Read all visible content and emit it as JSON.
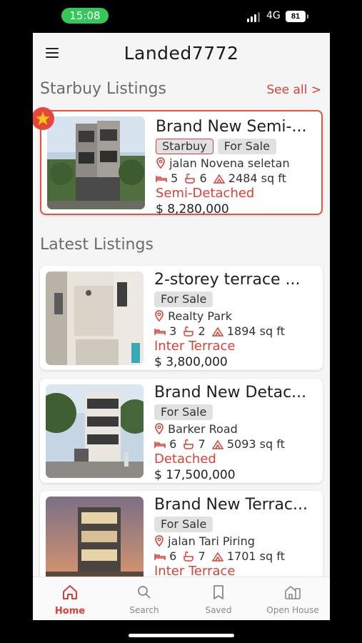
{
  "status_bar": {
    "time": "15:08",
    "network": "4G",
    "battery": "81"
  },
  "header": {
    "title": "Landed7772"
  },
  "starbuy": {
    "section_title": "Starbuy Listings",
    "see_all": "See all >",
    "listing": {
      "title": "Brand New Semi-...",
      "tags": [
        "Starbuy",
        "For Sale"
      ],
      "location": "jalan Novena seletan",
      "beds": "5",
      "baths": "6",
      "area": "2484 sq ft",
      "type": "Semi-Detached",
      "price": "$ 8,280,000"
    }
  },
  "latest": {
    "section_title": "Latest Listings",
    "listings": [
      {
        "title": "2-storey terrace ...",
        "tag": "For Sale",
        "location": "Realty Park",
        "beds": "3",
        "baths": "2",
        "area": "1894 sq ft",
        "type": "Inter Terrace",
        "price": "$ 3,800,000"
      },
      {
        "title": "Brand New Detac...",
        "tag": "For Sale",
        "location": "Barker Road",
        "beds": "6",
        "baths": "7",
        "area": "5093 sq ft",
        "type": "Detached",
        "price": "$ 17,500,000"
      },
      {
        "title": "Brand New Terrac...",
        "tag": "For Sale",
        "location": "jalan Tari Piring",
        "beds": "6",
        "baths": "7",
        "area": "1701 sq ft",
        "type": "Inter Terrace",
        "price": ""
      }
    ]
  },
  "bottom_nav": [
    {
      "label": "Home",
      "icon": "home-icon",
      "active": true
    },
    {
      "label": "Search",
      "icon": "search-icon",
      "active": false
    },
    {
      "label": "Saved",
      "icon": "bookmark-icon",
      "active": false
    },
    {
      "label": "Open House",
      "icon": "open-house-icon",
      "active": false
    }
  ],
  "colors": {
    "accent": "#d9403a",
    "tag_bg": "#e1e1e1",
    "status_green": "#34c759"
  }
}
